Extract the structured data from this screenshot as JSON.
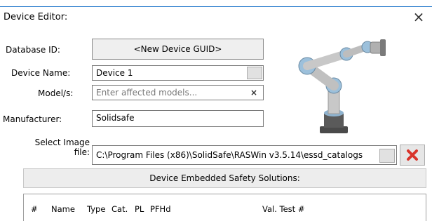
{
  "window": {
    "title": "Device Editor:",
    "close_glyph": "×"
  },
  "form": {
    "database_id": {
      "label": "Database ID:",
      "value": "<New Device GUID>"
    },
    "device_name": {
      "label": "Device Name:",
      "value": "Device 1"
    },
    "models": {
      "label": "Model/s:",
      "placeholder": "Enter affected models...",
      "clear_glyph": "×"
    },
    "manufacturer": {
      "label": "Manufacturer:",
      "value": "Solidsafe"
    },
    "select_image": {
      "label_line1": "Select Image",
      "label_line2": "file:",
      "value": "C:\\Program Files (x86)\\SolidSafe\\RASWin v3.5.14\\essd_catalogs"
    }
  },
  "image_preview": {
    "icon": "robot-arm-icon"
  },
  "safety_section": {
    "title": "Device Embedded Safety Solutions:",
    "columns": [
      "#",
      "Name",
      "Type",
      "Cat.",
      "PL",
      "PFHd",
      "Val. Test #"
    ]
  },
  "colors": {
    "delete_red": "#d9342b",
    "accent_blue": "#1a73c9"
  }
}
